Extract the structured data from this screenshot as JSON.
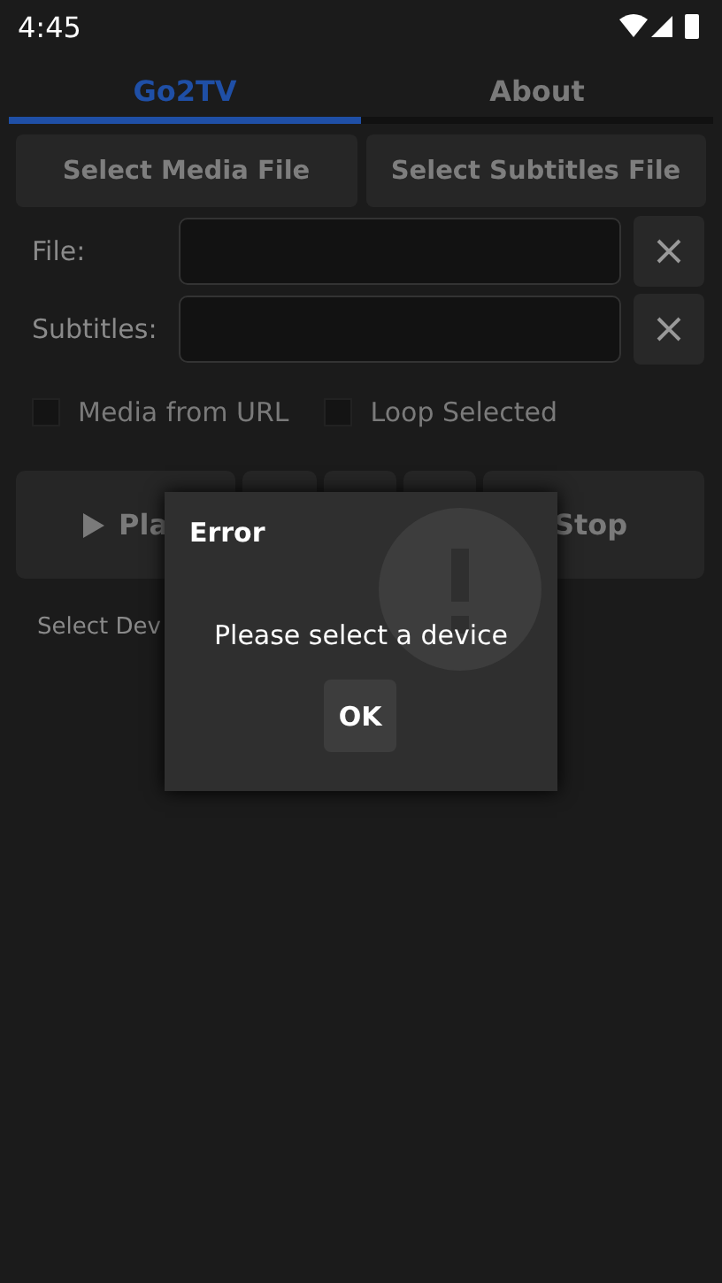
{
  "status_bar": {
    "time": "4:45"
  },
  "tabs": [
    {
      "label": "Go2TV",
      "selected": true
    },
    {
      "label": "About",
      "selected": false
    }
  ],
  "file_buttons": [
    "Select Media File",
    "Select Subtitles File"
  ],
  "fields": [
    {
      "label": "File:"
    },
    {
      "label": "Subtitles:"
    }
  ],
  "checkboxes": [
    {
      "label": "Media from URL",
      "checked": false
    },
    {
      "label": "Loop Selected",
      "checked": false
    }
  ],
  "controls": {
    "play": "Pla",
    "stop": "Stop"
  },
  "device_label": "Select Dev",
  "dialog": {
    "title": "Error",
    "message": "Please select a device",
    "button": "OK"
  }
}
